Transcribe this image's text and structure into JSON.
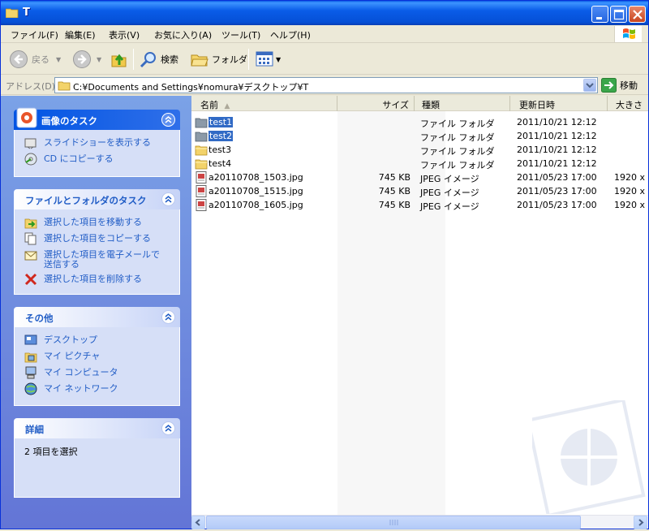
{
  "window": {
    "title": "T"
  },
  "menu": [
    "ファイル(F)",
    "編集(E)",
    "表示(V)",
    "お気に入り(A)",
    "ツール(T)",
    "ヘルプ(H)"
  ],
  "toolbar": {
    "back_label": "戻る",
    "search_label": "検索",
    "folders_label": "フォルダ"
  },
  "address": {
    "label": "アドレス(D)",
    "value": "C:¥Documents and Settings¥nomura¥デスクトップ¥T",
    "go_label": "移動"
  },
  "panels": {
    "picture_tasks": {
      "title": "画像のタスク",
      "items": [
        "スライドショーを表示する",
        "CD にコピーする"
      ]
    },
    "file_tasks": {
      "title": "ファイルとフォルダのタスク",
      "items": [
        "選択した項目を移動する",
        "選択した項目をコピーする",
        "選択した項目を電子メールで",
        "送信する",
        "選択した項目を削除する"
      ]
    },
    "other": {
      "title": "その他",
      "items": [
        "デスクトップ",
        "マイ ピクチャ",
        "マイ コンピュータ",
        "マイ ネットワーク"
      ]
    },
    "details": {
      "title": "詳細",
      "text": "2 項目を選択"
    }
  },
  "columns": [
    "名前",
    "サイズ",
    "種類",
    "更新日時",
    "大きさ"
  ],
  "files": [
    {
      "name": "test1",
      "size": "",
      "type": "ファイル フォルダ",
      "date": "2011/10/21 12:12",
      "dim": "",
      "kind": "folder",
      "selected": true
    },
    {
      "name": "test2",
      "size": "",
      "type": "ファイル フォルダ",
      "date": "2011/10/21 12:12",
      "dim": "",
      "kind": "folder",
      "selected": true
    },
    {
      "name": "test3",
      "size": "",
      "type": "ファイル フォルダ",
      "date": "2011/10/21 12:12",
      "dim": "",
      "kind": "folder",
      "selected": false
    },
    {
      "name": "test4",
      "size": "",
      "type": "ファイル フォルダ",
      "date": "2011/10/21 12:12",
      "dim": "",
      "kind": "folder",
      "selected": false
    },
    {
      "name": "a20110708_1503.jpg",
      "size": "745 KB",
      "type": "JPEG イメージ",
      "date": "2011/05/23 17:00",
      "dim": "1920 x",
      "kind": "jpeg",
      "selected": false
    },
    {
      "name": "a20110708_1515.jpg",
      "size": "745 KB",
      "type": "JPEG イメージ",
      "date": "2011/05/23 17:00",
      "dim": "1920 x",
      "kind": "jpeg",
      "selected": false
    },
    {
      "name": "a20110708_1605.jpg",
      "size": "745 KB",
      "type": "JPEG イメージ",
      "date": "2011/05/23 17:00",
      "dim": "1920 x",
      "kind": "jpeg",
      "selected": false
    }
  ],
  "colors": {
    "title_bar": "#0a5ce8",
    "selection": "#316ac5",
    "task_link": "#215dc6",
    "left_pane": "#7ba2e7"
  }
}
